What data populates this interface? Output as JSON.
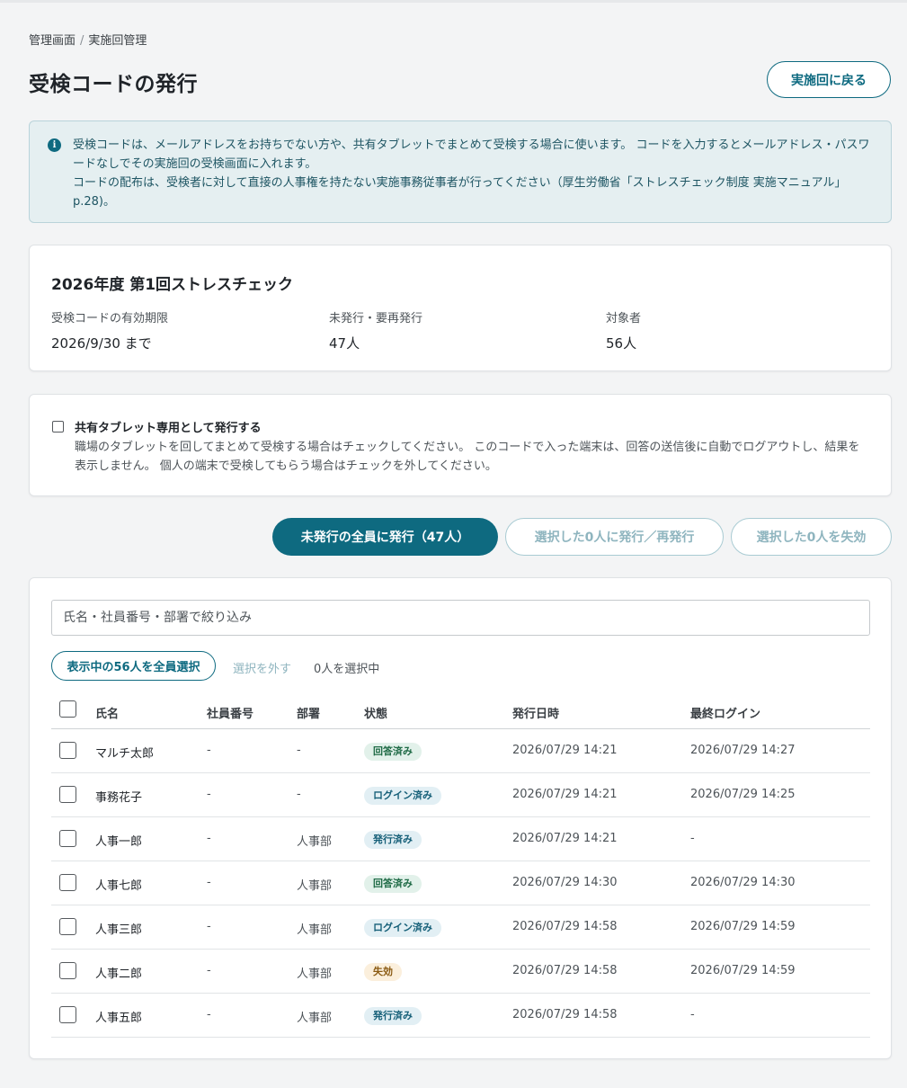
{
  "breadcrumb": {
    "items": [
      "管理画面",
      "実施回管理"
    ],
    "separator": "/"
  },
  "page": {
    "title": "受検コードの発行",
    "back_label": "実施回に戻る"
  },
  "info": {
    "icon": "info-icon",
    "line1": "受検コードは、メールアドレスをお持ちでない方や、共有タブレットでまとめて受検する場合に使います。 コードを入力するとメールアドレス・パスワードなしでその実施回の受検画面に入れます。",
    "line2": "コードの配布は、受検者に対して直接の人事権を持たない実施事務従事者が行ってください（厚生労働省「ストレスチェック制度 実施マニュアル」p.28)。"
  },
  "summary": {
    "title": "2026年度 第1回ストレスチェック",
    "stats": [
      {
        "label": "受検コードの有効期限",
        "value": "2026/9/30 まで"
      },
      {
        "label": "未発行・要再発行",
        "value": "47人"
      },
      {
        "label": "対象者",
        "value": "56人"
      }
    ]
  },
  "tablet": {
    "label": "共有タブレット専用として発行する",
    "description": "職場のタブレットを回してまとめて受検する場合はチェックしてください。 このコードで入った端末は、回答の送信後に自動でログアウトし、結果を表示しません。 個人の端末で受検してもらう場合はチェックを外してください。",
    "checked": false
  },
  "actions": {
    "issue_all": "未発行の全員に発行（47人）",
    "issue_selected": "選択した0人に発行／再発行",
    "revoke_selected": "選択した0人を失効"
  },
  "list": {
    "filter_placeholder": "氏名・社員番号・部署で絞り込み",
    "select_all_label": "表示中の56人を全員選択",
    "unselect_label": "選択を外す",
    "selected_count": "0人を選択中",
    "columns": [
      "氏名",
      "社員番号",
      "部署",
      "状態",
      "発行日時",
      "最終ログイン"
    ],
    "rows": [
      {
        "name": "マルチ太郎",
        "employee_no": "-",
        "department": "-",
        "status": "回答済み",
        "status_type": "answered",
        "issued_at": "2026/07/29 14:21",
        "last_login": "2026/07/29 14:27"
      },
      {
        "name": "事務花子",
        "employee_no": "-",
        "department": "-",
        "status": "ログイン済み",
        "status_type": "login",
        "issued_at": "2026/07/29 14:21",
        "last_login": "2026/07/29 14:25"
      },
      {
        "name": "人事一郎",
        "employee_no": "-",
        "department": "人事部",
        "status": "発行済み",
        "status_type": "issued",
        "issued_at": "2026/07/29 14:21",
        "last_login": "-"
      },
      {
        "name": "人事七郎",
        "employee_no": "-",
        "department": "人事部",
        "status": "回答済み",
        "status_type": "answered",
        "issued_at": "2026/07/29 14:30",
        "last_login": "2026/07/29 14:30"
      },
      {
        "name": "人事三郎",
        "employee_no": "-",
        "department": "人事部",
        "status": "ログイン済み",
        "status_type": "login",
        "issued_at": "2026/07/29 14:58",
        "last_login": "2026/07/29 14:59"
      },
      {
        "name": "人事二郎",
        "employee_no": "-",
        "department": "人事部",
        "status": "失効",
        "status_type": "revoked",
        "issued_at": "2026/07/29 14:58",
        "last_login": "2026/07/29 14:59"
      },
      {
        "name": "人事五郎",
        "employee_no": "-",
        "department": "人事部",
        "status": "発行済み",
        "status_type": "issued",
        "issued_at": "2026/07/29 14:58",
        "last_login": "-"
      }
    ]
  },
  "colors": {
    "accent": "#0e6a80",
    "info_bg": "#e5eff1",
    "page_bg": "#f3f4f5"
  }
}
